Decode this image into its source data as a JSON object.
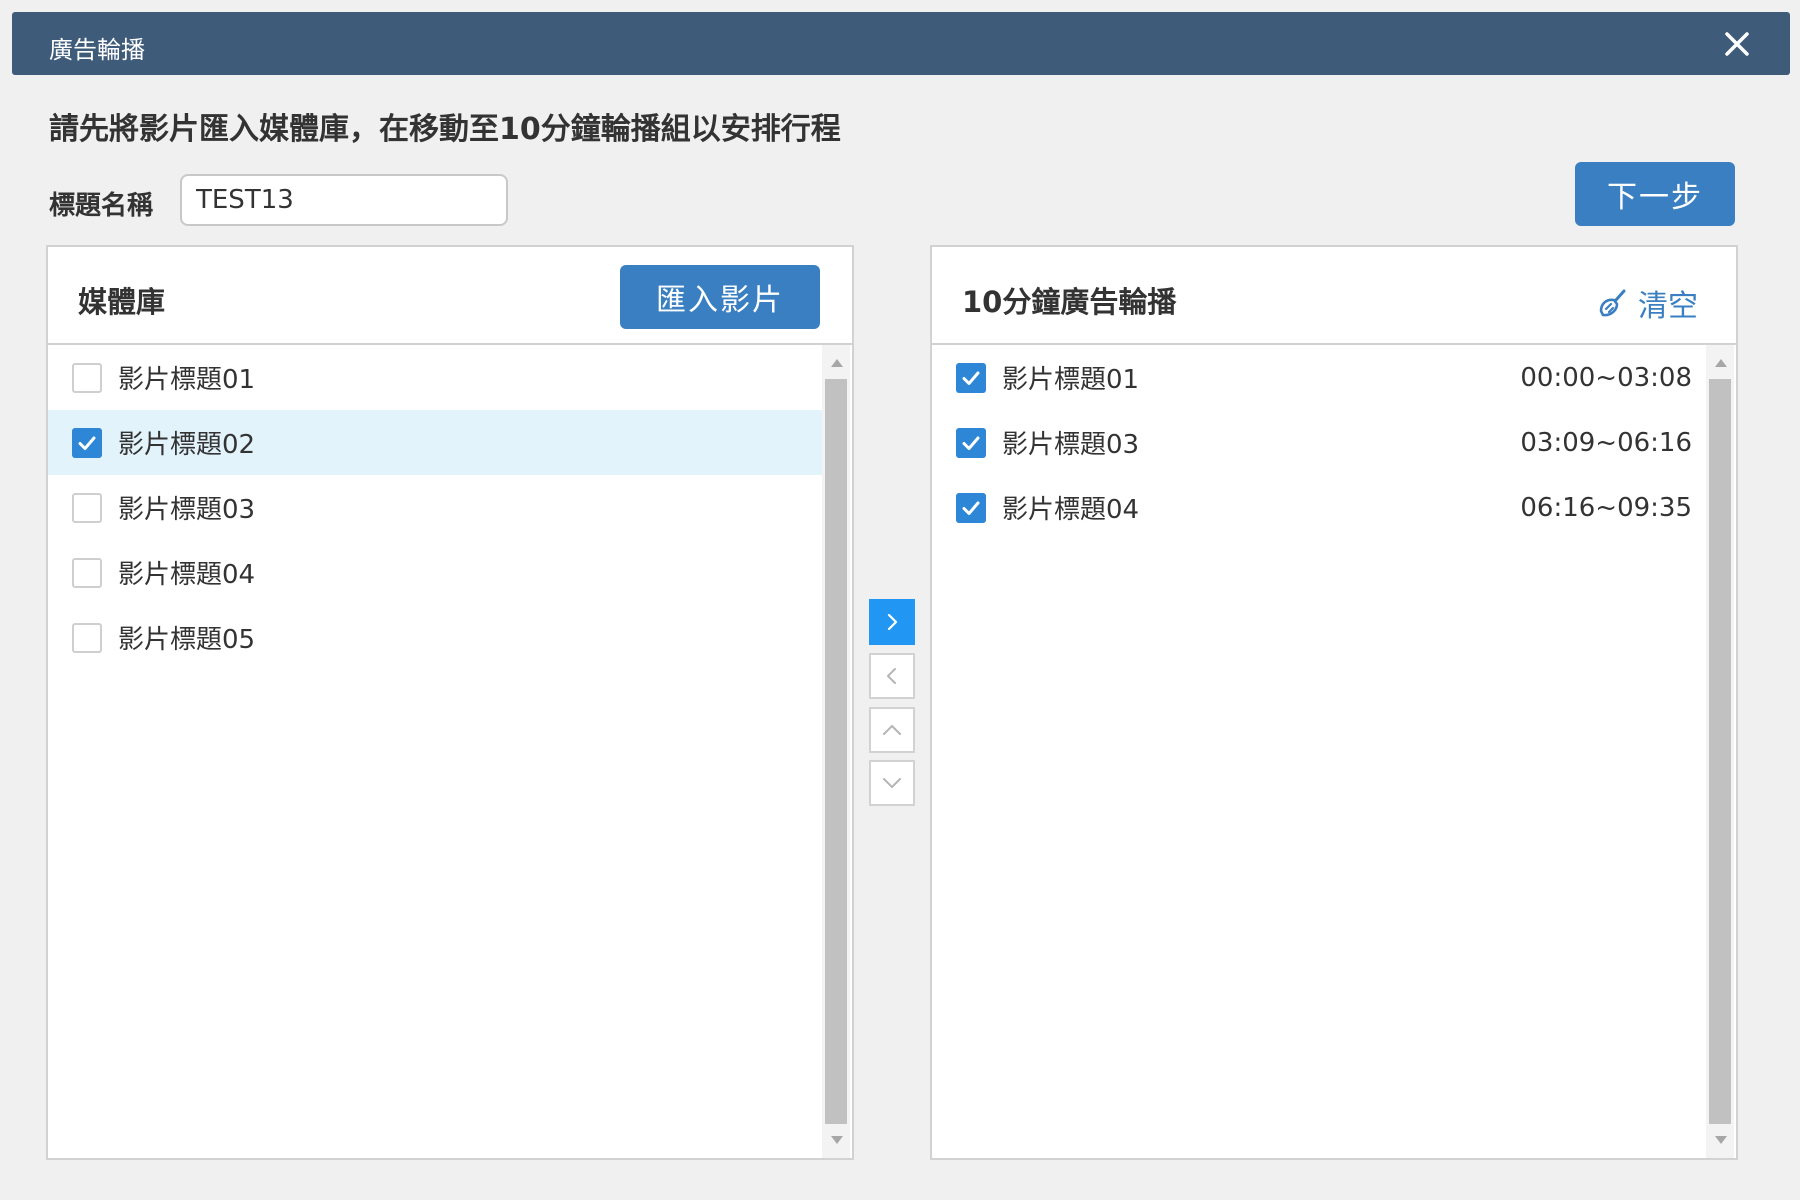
{
  "dialog": {
    "title": "廣告輪播",
    "instruction": "請先將影片匯入媒體庫，在移動至10分鐘輪播組以安排行程",
    "title_field_label": "標題名稱",
    "title_field_value": "TEST13",
    "next_label": "下一步"
  },
  "library": {
    "title": "媒體庫",
    "import_label": "匯入影片",
    "items": [
      {
        "label": "影片標題01",
        "checked": false
      },
      {
        "label": "影片標題02",
        "checked": true
      },
      {
        "label": "影片標題03",
        "checked": false
      },
      {
        "label": "影片標題04",
        "checked": false
      },
      {
        "label": "影片標題05",
        "checked": false
      }
    ]
  },
  "playlist": {
    "title": "10分鐘廣告輪播",
    "clear_label": "清空",
    "items": [
      {
        "label": "影片標題01",
        "time": "00:00~03:08",
        "checked": true
      },
      {
        "label": "影片標題03",
        "time": "03:09~06:16",
        "checked": true
      },
      {
        "label": "影片標題04",
        "time": "06:16~09:35",
        "checked": true
      }
    ]
  },
  "transfer_buttons": [
    "chevron-right-icon",
    "chevron-left-icon",
    "chevron-up-icon",
    "chevron-down-icon"
  ],
  "colors": {
    "header_bar": "#3e5b7a",
    "primary_button": "#3a7fc1",
    "checkbox_checked": "#2e86d6",
    "selected_row": "#e3f3fc",
    "transfer_active": "#2196f3"
  }
}
